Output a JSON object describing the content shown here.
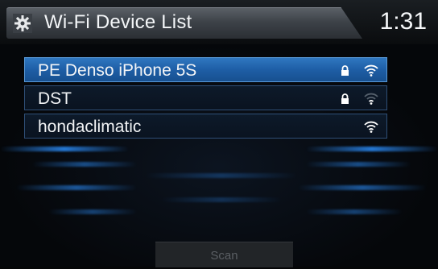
{
  "header": {
    "title": "Wi-Fi Device List",
    "clock": "1:31",
    "icon": "settings-icon"
  },
  "devices": [
    {
      "name": "PE Denso iPhone 5S",
      "secured": true,
      "signal": "strong",
      "selected": true
    },
    {
      "name": "DST",
      "secured": true,
      "signal": "weak",
      "selected": false
    },
    {
      "name": "hondaclimatic",
      "secured": false,
      "signal": "strong",
      "selected": false
    }
  ],
  "scan_button": {
    "label": "Scan",
    "enabled": false
  },
  "colors": {
    "selected_row": "#1e5ea6",
    "row_border": "#2f4f77",
    "background": "#050607"
  }
}
